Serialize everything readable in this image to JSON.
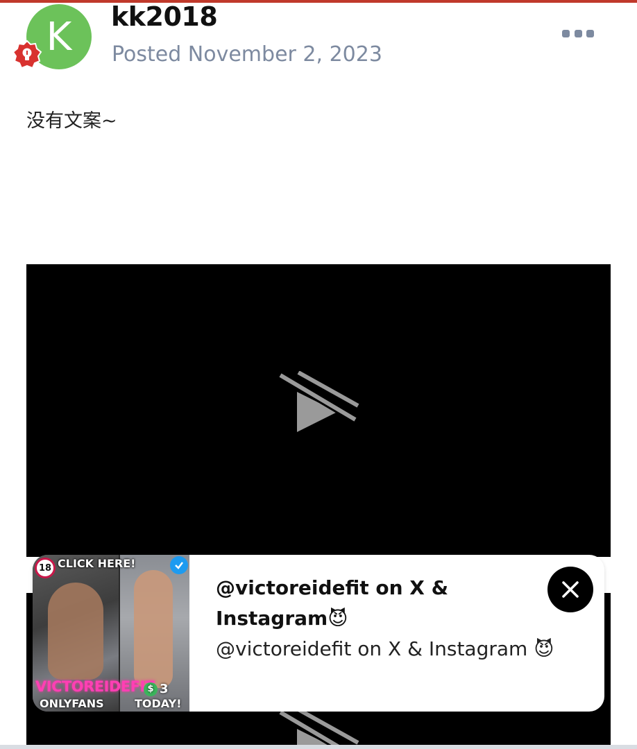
{
  "post": {
    "username": "kk2018",
    "avatar_letter": "K",
    "avatar_color": "#6cc25a",
    "badge_icon": "lightbulb-icon",
    "badge_color": "#d8322f",
    "posted": "Posted November 2, 2023",
    "more_icon": "ellipsis-icon",
    "text": "没有文案~"
  },
  "video": {
    "state_icon": "video-unavailable-icon"
  },
  "ad": {
    "thumbnail": {
      "age_badge": "18",
      "cta": "CLICK HERE!",
      "brand": "VICTOREIDEFIT",
      "platform": "ONLYFANS",
      "price_symbol": "$",
      "price": "3",
      "today": "TODAY!"
    },
    "title": "@victoreidefit on X & Instagram😈",
    "description": "@victoreidefit on X & Instagram 😈",
    "close_icon": "close-icon"
  },
  "colors": {
    "accent_top": "#c0392b",
    "muted_text": "#7d8aa0"
  }
}
